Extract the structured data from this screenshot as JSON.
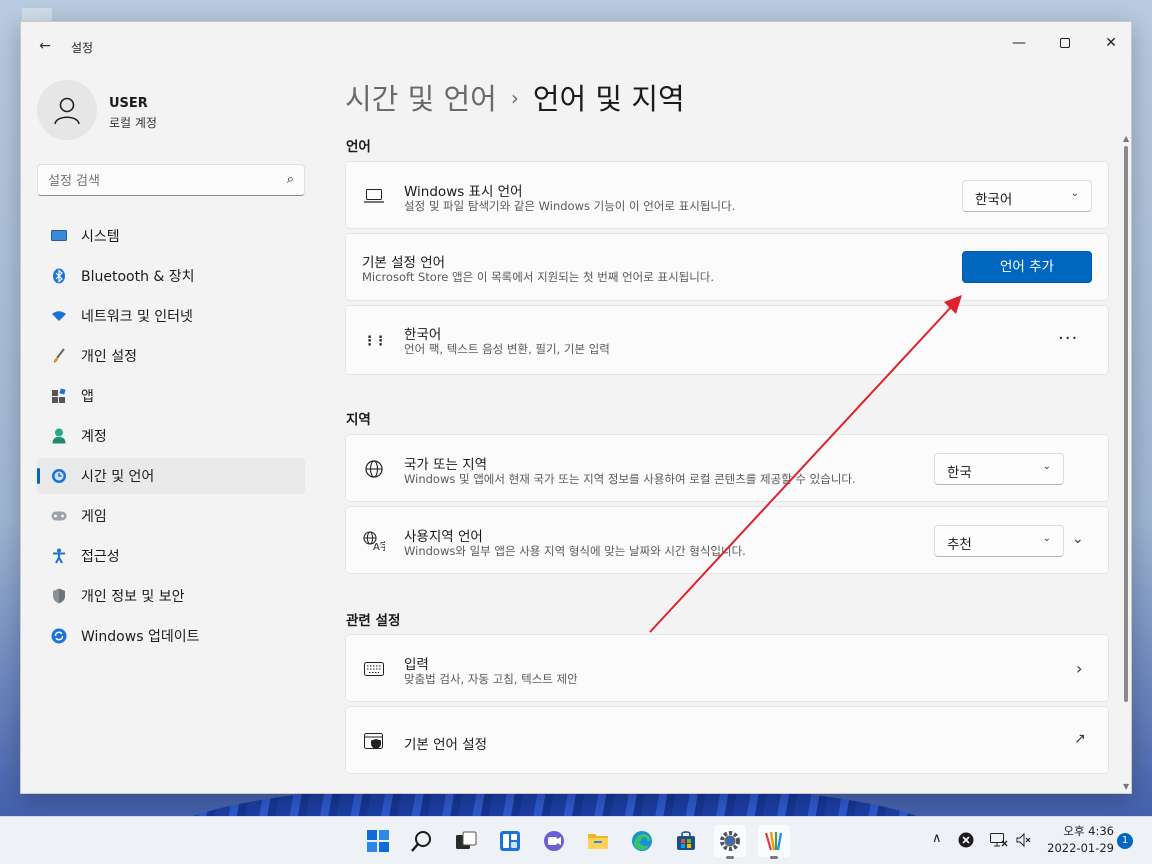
{
  "window": {
    "app_title": "설정",
    "back_icon": "←",
    "minimize_icon": "—",
    "close_icon": "✕"
  },
  "profile": {
    "name": "USER",
    "account_type": "로컬 계정"
  },
  "search": {
    "placeholder": "설정 검색",
    "icon": "⌕"
  },
  "nav": {
    "items": [
      {
        "label": "시스템",
        "icon": "system-icon"
      },
      {
        "label": "Bluetooth & 장치",
        "icon": "bluetooth-icon"
      },
      {
        "label": "네트워크 및 인터넷",
        "icon": "wifi-icon"
      },
      {
        "label": "개인 설정",
        "icon": "brush-icon"
      },
      {
        "label": "앱",
        "icon": "apps-icon"
      },
      {
        "label": "계정",
        "icon": "account-icon"
      },
      {
        "label": "시간 및 언어",
        "icon": "time-language-icon",
        "active": true
      },
      {
        "label": "게임",
        "icon": "gamepad-icon"
      },
      {
        "label": "접근성",
        "icon": "accessibility-icon"
      },
      {
        "label": "개인 정보 및 보안",
        "icon": "shield-icon"
      },
      {
        "label": "Windows 업데이트",
        "icon": "update-icon"
      }
    ]
  },
  "breadcrumb": {
    "parent": "시간 및 언어",
    "separator": "›",
    "current": "언어 및 지역"
  },
  "language": {
    "section_title": "언어",
    "display_language": {
      "title": "Windows 표시 언어",
      "desc": "설정 및 파일 탐색기와 같은 Windows 기능이 이 언어로 표시됩니다.",
      "value": "한국어"
    },
    "preferred": {
      "title": "기본 설정 언어",
      "desc": "Microsoft Store 앱은 이 목록에서 지원되는 첫 번째 언어로 표시됩니다.",
      "button": "언어 추가"
    },
    "korean": {
      "title": "한국어",
      "desc": "언어 팩, 텍스트 음성 변환, 필기, 기본 입력",
      "more": "···",
      "drag": "⋮⋮"
    }
  },
  "region": {
    "section_title": "지역",
    "country": {
      "title": "국가 또는 지역",
      "desc": "Windows 및 앱에서 현재 국가 또는 지역 정보를 사용하여 로컬 콘텐츠를 제공할 수 있습니다.",
      "value": "한국"
    },
    "format": {
      "title": "사용지역 언어",
      "desc": "Windows와 일부 앱은 사용 지역 형식에 맞는 날짜와 시간 형식입니다.",
      "value": "추천",
      "expand": "⌄"
    }
  },
  "related": {
    "section_title": "관련 설정",
    "input": {
      "title": "입력",
      "desc": "맞춤법 검사, 자동 고침, 텍스트 제안",
      "chevron": "›"
    },
    "admin_language": {
      "title": "기본 언어 설정",
      "link_icon": "↗"
    }
  },
  "taskbar": {
    "apps": [
      "start-icon",
      "search-icon",
      "task-view-icon",
      "widgets-icon",
      "teams-chat-icon",
      "file-explorer-icon",
      "edge-icon",
      "store-icon",
      "settings-icon",
      "pen-app-icon"
    ],
    "tray_chevron": "∧",
    "time": "오후 4:36",
    "date": "2022-01-29",
    "notification_count": "1"
  },
  "colors": {
    "accent": "#0067c0",
    "annotation_arrow": "#e0202a",
    "window_bg": "#f3f3f3",
    "card_bg": "#fbfbfb"
  }
}
